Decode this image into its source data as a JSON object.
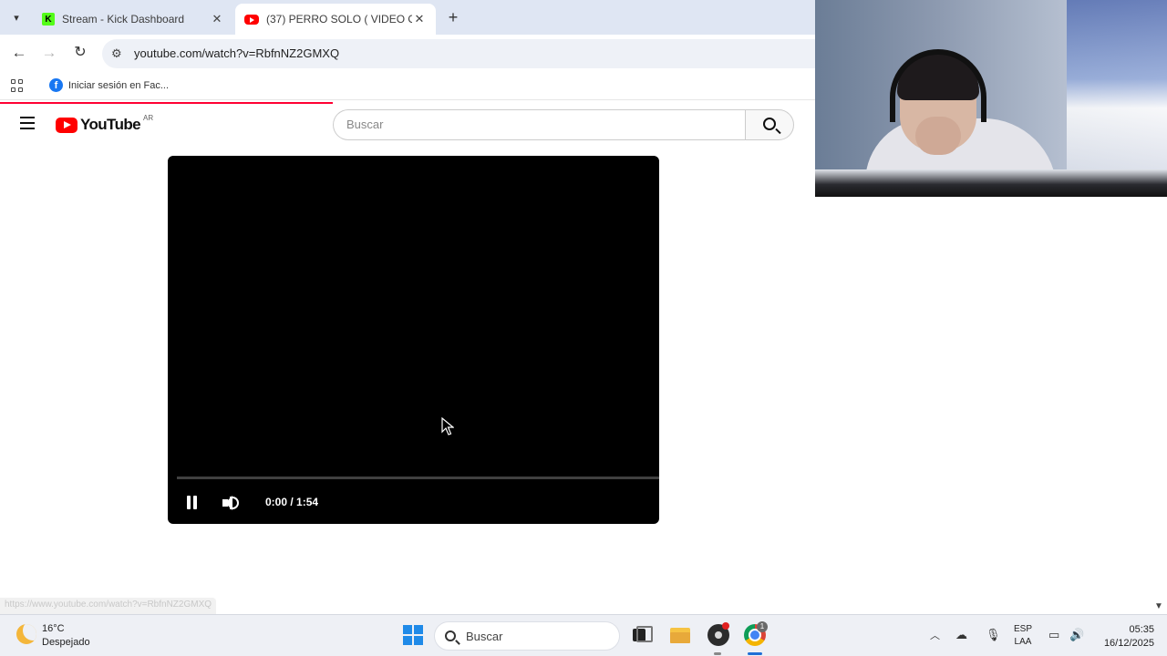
{
  "browser": {
    "tabs": [
      {
        "title": "Stream - Kick Dashboard",
        "active": false
      },
      {
        "title": "(37) PERRO SOLO ( VIDEO OFIC",
        "active": true
      }
    ],
    "address": "youtube.com/watch?v=RbfnNZ2GMXQ",
    "bookmarks": [
      {
        "label": "Iniciar sesión en Fac..."
      }
    ],
    "status_link": "https://www.youtube.com/watch?v=RbfnNZ2GMXQ"
  },
  "youtube": {
    "logo_text": "YouTube",
    "region": "AR",
    "search_placeholder": "Buscar"
  },
  "player": {
    "time": "0:00 / 1:54",
    "progress_fraction": 0.0,
    "state": "playing"
  },
  "taskbar": {
    "weather": {
      "temp": "16°C",
      "condition": "Despejado"
    },
    "search_label": "Buscar",
    "chrome_badge": "1",
    "language": {
      "line1": "ESP",
      "line2": "LAA"
    },
    "clock": {
      "time": "05:35",
      "date": "16/12/2025"
    }
  },
  "colors": {
    "youtube_red": "#ff0000",
    "kick_green": "#53fc18",
    "windows_blue": "#1f8ae8"
  }
}
